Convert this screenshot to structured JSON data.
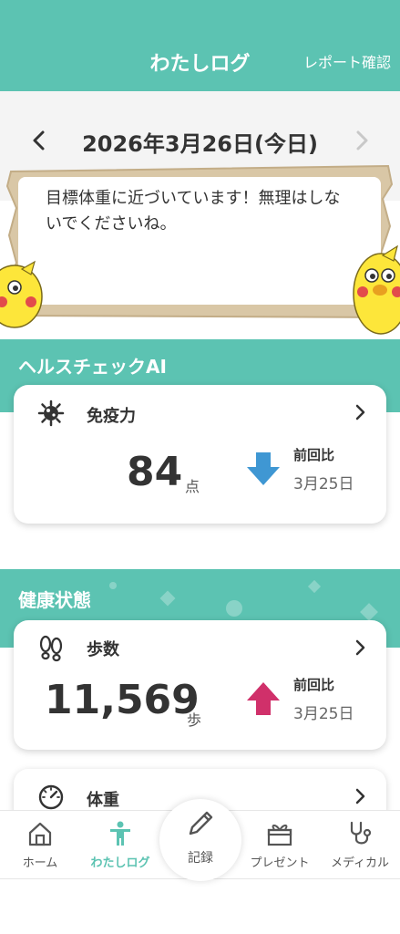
{
  "header": {
    "title": "わたしログ",
    "report_link": "レポート確認"
  },
  "date_nav": {
    "date": "2026年3月26日(今日)"
  },
  "message": {
    "text": "目標体重に近づいています！無理はしないでくださいね。"
  },
  "health_check": {
    "section_title": "ヘルスチェックAI",
    "immunity": {
      "label": "免疫力",
      "value": "84",
      "unit": "点",
      "trend": "down",
      "compare_label": "前回比",
      "compare_date": "3月25日",
      "trend_color": "#3f97d3"
    }
  },
  "health_status": {
    "section_title": "健康状態",
    "steps": {
      "label": "歩数",
      "value": "11,569",
      "unit": "歩",
      "trend": "up",
      "compare_label": "前回比",
      "compare_date": "3月25日",
      "trend_color": "#d0306a"
    },
    "weight": {
      "label": "体重"
    }
  },
  "tabbar": {
    "home": "ホーム",
    "mylog": "わたしログ",
    "record": "記録",
    "present": "プレゼント",
    "medical": "メディカル"
  },
  "colors": {
    "accent": "#5cc3b2",
    "board": "#d9c7a6"
  }
}
